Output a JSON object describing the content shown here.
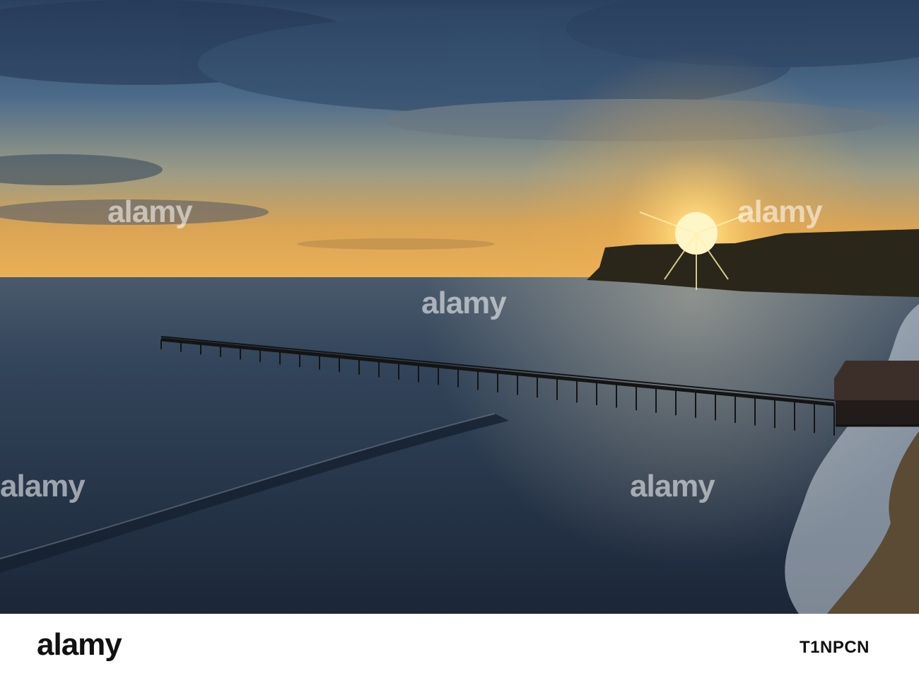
{
  "footer": {
    "brand": "alamy",
    "image_id": "T1NPCN"
  },
  "watermark": {
    "text": "alamy"
  },
  "colors": {
    "sky_top": "#2d4362",
    "sky_horizon": "#e8a94a",
    "sea": "#253448",
    "cliff": "#2a261c",
    "sun": "#fff6c8"
  }
}
